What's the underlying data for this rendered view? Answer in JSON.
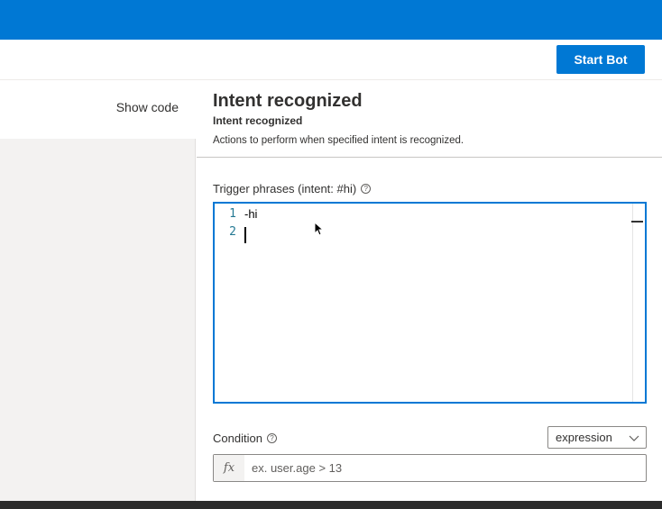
{
  "toolbar": {
    "start_bot_label": "Start Bot"
  },
  "left_pane": {
    "show_code_label": "Show code"
  },
  "panel": {
    "title": "Intent recognized",
    "subtitle": "Intent recognized",
    "description": "Actions to perform when specified intent is recognized."
  },
  "trigger": {
    "label": "Trigger phrases (intent: #hi)",
    "help_icon": "?",
    "lines": [
      {
        "number": "1",
        "text": "-hi"
      },
      {
        "number": "2",
        "text": ""
      }
    ]
  },
  "condition": {
    "label": "Condition",
    "help_icon": "?",
    "mode_selected": "expression",
    "fx_symbol": "fx",
    "placeholder": "ex. user.age > 13"
  },
  "icons": {
    "help": "help-circle-icon",
    "dropdown": "chevron-down-icon",
    "function": "fx-icon",
    "cursor": "mouse-pointer-icon"
  },
  "colors": {
    "accent": "#0078d4",
    "line_number": "#237893",
    "pane_bg": "#f3f2f1",
    "bottom_bar": "#2b2b2b"
  }
}
